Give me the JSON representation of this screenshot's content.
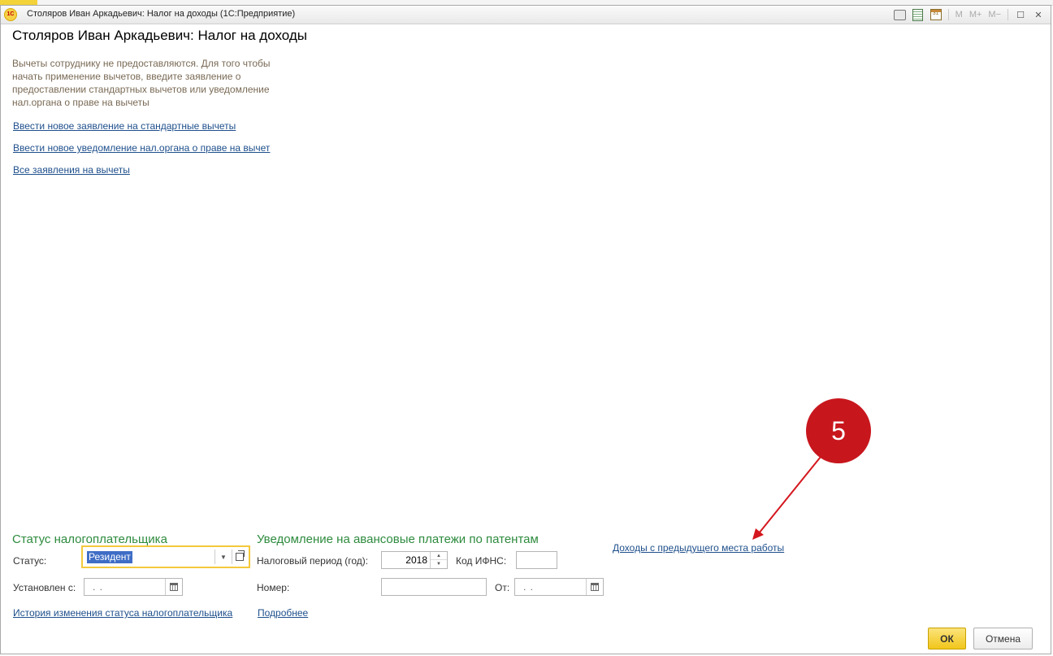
{
  "window": {
    "title": "Столяров Иван Аркадьевич: Налог на доходы  (1С:Предприятие)",
    "logo_text": "1С",
    "toolbar": {
      "m_label": "M",
      "mplus_label": "M+",
      "mminus_label": "M−",
      "calendar_day": "31",
      "maximize_glyph": "☐",
      "close_glyph": "✕"
    }
  },
  "page_title": "Столяров Иван Аркадьевич: Налог на доходы",
  "info_text": "Вычеты сотруднику не предоставляются. Для того чтобы начать применение вычетов, введите заявление о предоставлении стандартных вычетов или уведомление нал.органа о праве на вычеты",
  "links": {
    "new_standard": "Ввести новое заявление на стандартные вычеты",
    "new_notice": "Ввести новое уведомление нал.органа о праве на вычет",
    "all_applications": "Все заявления на вычеты",
    "status_history": "История изменения статуса налогоплательщика",
    "details": "Подробнее",
    "prev_income": "Доходы с предыдущего места работы"
  },
  "taxpayer_status": {
    "section_title": "Статус налогоплательщика",
    "status_label": "Статус:",
    "status_value": "Резидент",
    "established_label": "Установлен с:",
    "established_value": " .  . "
  },
  "patent_notice": {
    "section_title": "Уведомление на авансовые платежи по патентам",
    "period_label": "Налоговый период (год):",
    "period_value": "2018",
    "ifns_label": "Код ИФНС:",
    "ifns_value": "",
    "number_label": "Номер:",
    "number_value": "",
    "from_label": "От:",
    "from_value": " .  . "
  },
  "buttons": {
    "ok": "ОК",
    "cancel": "Отмена"
  },
  "annotation": {
    "marker_number": "5",
    "marker_color": "#c8161d"
  }
}
